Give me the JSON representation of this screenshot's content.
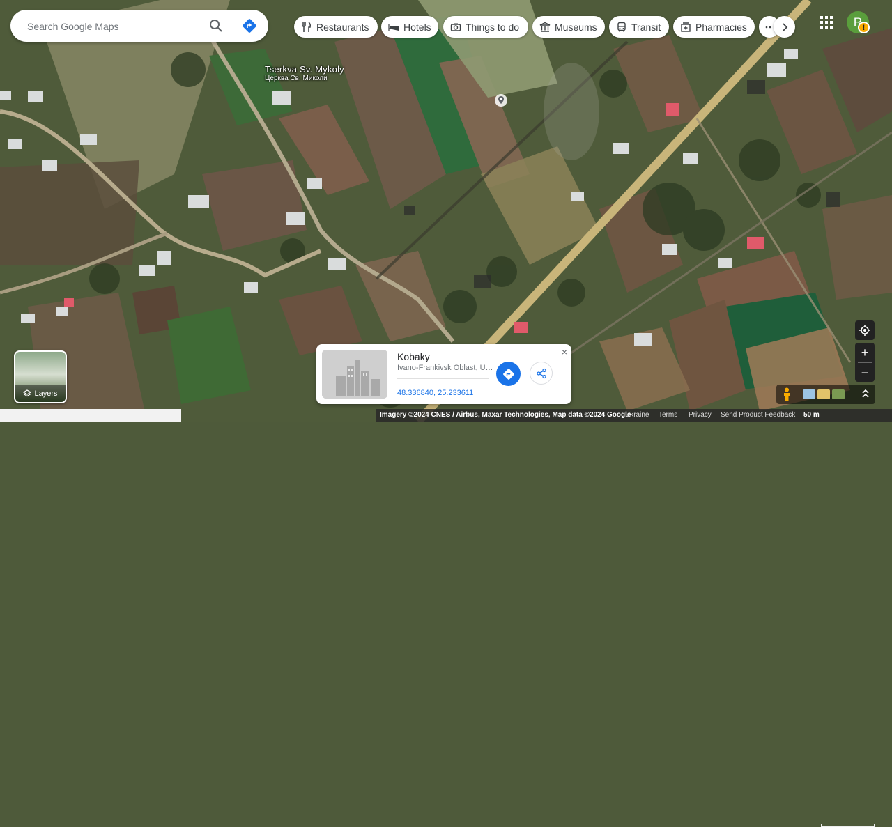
{
  "search": {
    "placeholder": "Search Google Maps"
  },
  "chips": [
    {
      "label": "Restaurants",
      "icon": "fork-knife-icon"
    },
    {
      "label": "Hotels",
      "icon": "bed-icon"
    },
    {
      "label": "Things to do",
      "icon": "camera-icon"
    },
    {
      "label": "Museums",
      "icon": "museum-icon"
    },
    {
      "label": "Transit",
      "icon": "bus-icon"
    },
    {
      "label": "Pharmacies",
      "icon": "pharmacy-icon"
    }
  ],
  "account": {
    "initial": "R",
    "alert": "!"
  },
  "poi": {
    "name": "Tserkva Sv. Mykoly",
    "local_name": "Церква Св. Миколи"
  },
  "layers": {
    "label": "Layers"
  },
  "place_card": {
    "title": "Kobaky",
    "subtitle": "Ivano-Frankivsk Oblast, Ukraine",
    "coordinates": "48.336840, 25.233611",
    "close": "×"
  },
  "controls": {
    "zoom_in": "+",
    "zoom_out": "−"
  },
  "footer": {
    "imagery": "Imagery ©2024 CNES / Airbus, Maxar Technologies, Map data ©2024 Google",
    "ukraine": "Ukraine",
    "terms": "Terms",
    "privacy": "Privacy",
    "feedback": "Send Product Feedback",
    "scale": "50 m"
  },
  "colors": {
    "accent": "#1a73e8",
    "road": "#c9b57a"
  }
}
